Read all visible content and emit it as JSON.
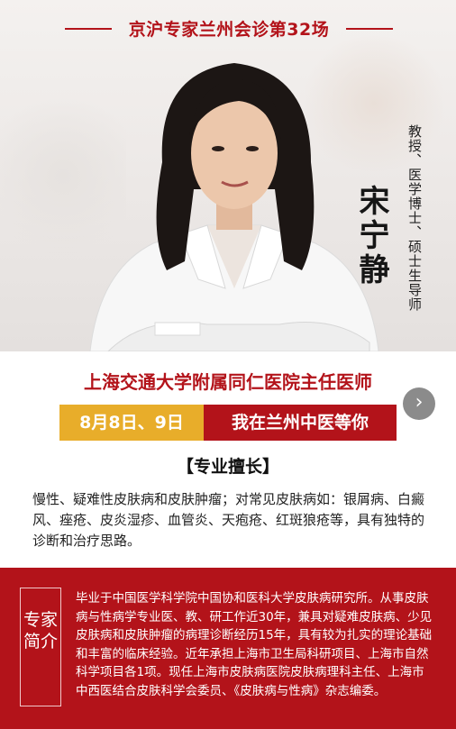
{
  "header": {
    "title": "京沪专家兰州会诊第32场"
  },
  "doctor": {
    "name": "宋宁静",
    "titles": "教授、医学博士、硕士生导师",
    "hospital": "上海交通大学附属同仁医院主任医师"
  },
  "schedule": {
    "dates": "8月8日、9日",
    "place": "我在兰州中医等你"
  },
  "next_button": {
    "icon": "chevron-right-icon",
    "glyph": "›"
  },
  "specialty": {
    "heading": "【专业擅长】",
    "text": "慢性、疑难性皮肤病和皮肤肿瘤；对常见皮肤病如：银屑病、白癜风、痤疮、皮炎湿疹、血管炎、天疱疮、红斑狼疮等，具有独特的诊断和治疗思路。"
  },
  "intro": {
    "label": "专家简介",
    "text": "毕业于中国医学科学院中国协和医科大学皮肤病研究所。从事皮肤病与性病学专业医、教、研工作近30年，兼具对疑难皮肤病、少见皮肤病和皮肤肿瘤的病理诊断经历15年，具有较为扎实的理论基础和丰富的临床经验。近年承担上海市卫生局科研项目、上海市自然科学项目各1项。现任上海市皮肤病医院皮肤病理科主任、上海市中西医结合皮肤科学会委员、《皮肤病与性病》杂志编委。"
  },
  "colors": {
    "accent_red": "#b3131a",
    "accent_gold": "#e8ad2a"
  }
}
